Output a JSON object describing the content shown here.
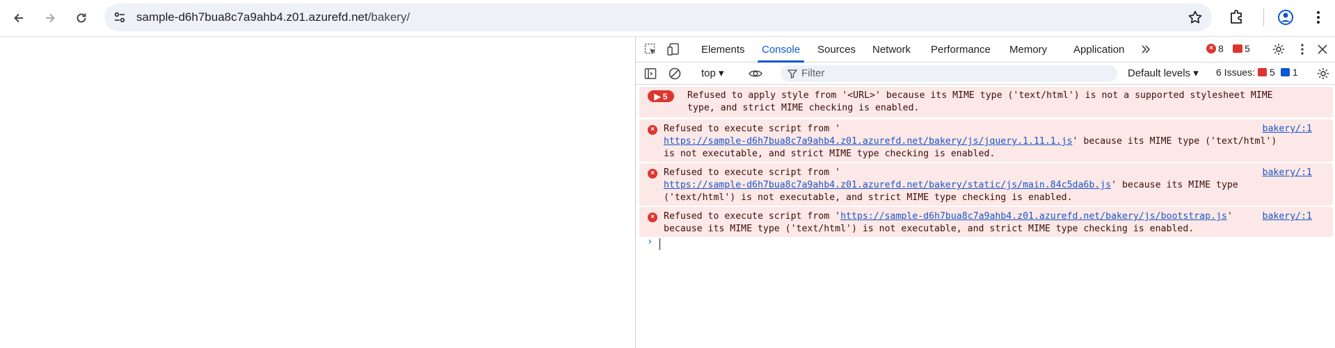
{
  "browser": {
    "url_host": "sample-d6h7bua8c7a9ahb4.z01.azurefd.net",
    "url_path": "/bakery/"
  },
  "devtools": {
    "tabs": [
      "Elements",
      "Console",
      "Sources",
      "Network",
      "Performance",
      "Memory",
      "Application"
    ],
    "active_tab": "Console",
    "error_count": "8",
    "warning_count": "5",
    "context": "top",
    "filter_placeholder": "Filter",
    "levels": "Default levels",
    "issues_label": "6 Issues:",
    "issues_errors": "5",
    "issues_info": "1"
  },
  "console": {
    "group_count": "5",
    "messages": [
      {
        "lines": [
          "Refused to apply style from '<URL>' because its MIME type ('text/html') is not a supported stylesheet MIME",
          "type, and strict MIME checking is enabled."
        ]
      },
      {
        "source": "bakery/:1",
        "pre": "Refused to execute script from '",
        "link": "https://sample-d6h7bua8c7a9ahb4.z01.azurefd.net/bakery/js/jquery.1.11.1.js",
        "post": "' because its MIME type ('text/html')",
        "tail": "is not executable, and strict MIME type checking is enabled."
      },
      {
        "source": "bakery/:1",
        "pre": "Refused to execute script from '",
        "link": "https://sample-d6h7bua8c7a9ahb4.z01.azurefd.net/bakery/static/js/main.84c5da6b.js",
        "post": "' because its MIME type",
        "tail": "('text/html') is not executable, and strict MIME type checking is enabled."
      },
      {
        "source": "bakery/:1",
        "pre": "Refused to execute script from '",
        "link": "https://sample-d6h7bua8c7a9ahb4.z01.azurefd.net/bakery/js/bootstrap.js",
        "post": "'",
        "tail": "because its MIME type ('text/html') is not executable, and strict MIME type checking is enabled."
      }
    ]
  },
  "colors": {
    "accent": "#0b57d0",
    "error": "#dc362e",
    "error_bg": "#fce8e6",
    "link": "#1a55cc"
  }
}
